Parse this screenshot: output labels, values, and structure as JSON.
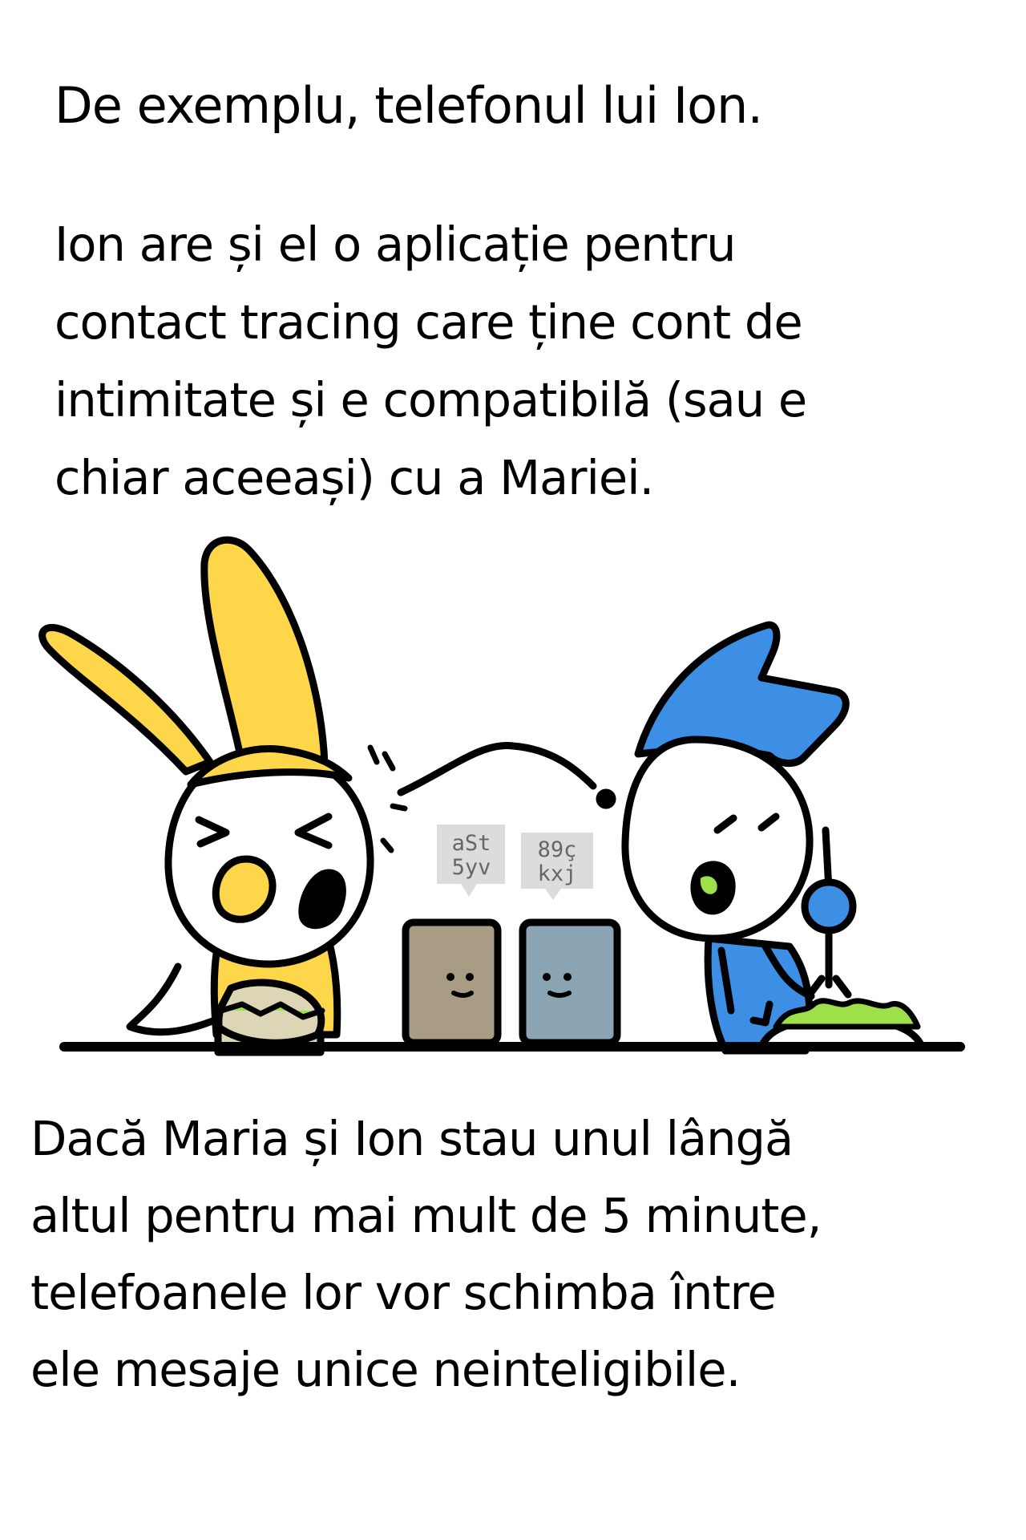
{
  "captions": {
    "title": "De exemplu, telefonul lui Ion.",
    "intro_lines": [
      "Ion are și el o aplicație pentru",
      "contact tracing care ține cont de",
      "intimitate și e compatibilă (sau e",
      "chiar aceeași) cu a Mariei."
    ],
    "bottom_lines": [
      "Dacă Maria și Ion stau unul lângă",
      "altul pentru mai mult de 5 minute,",
      "telefoanele lor vor schimba între",
      "ele mesaje unice neinteligibile."
    ]
  },
  "phones": {
    "left": {
      "message_lines": [
        "aSt",
        "5yv"
      ],
      "color": "#a89c84"
    },
    "right": {
      "message_lines": [
        "89ç",
        "kxj"
      ],
      "color": "#8aa4b4"
    }
  },
  "colors": {
    "rabbit": "#fdd64a",
    "rabbit_inner_ear": "#fdd64a",
    "hat": "#3d8fe6",
    "sandwich": "#ddd6b6",
    "salad": "#9ee04a",
    "bubble": "#dcdcdc",
    "ink": "#000000"
  }
}
